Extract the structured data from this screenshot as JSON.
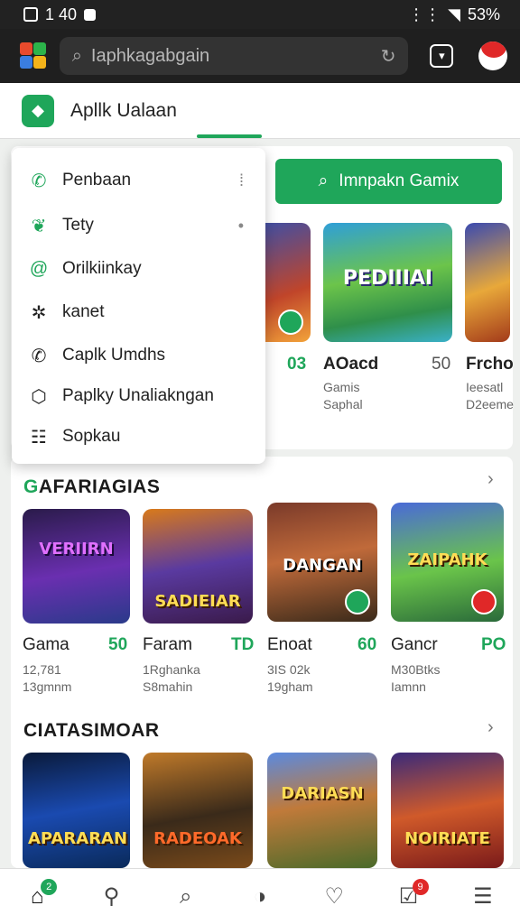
{
  "status_bar": {
    "time": "1 40",
    "battery": "53%"
  },
  "topbar": {
    "search_text": "Iaphkagabgain"
  },
  "header": {
    "title": "Apllk Ualaan"
  },
  "menu": {
    "items": [
      {
        "label": "Penbaan",
        "icon": "phone-icon"
      },
      {
        "label": "Tety",
        "icon": "leaf-icon"
      },
      {
        "label": "Orilkiinkay",
        "icon": "link-icon"
      },
      {
        "label": "kanet",
        "icon": "gear-icon"
      },
      {
        "label": "Caplk Umdhs",
        "icon": "phone-outline-icon"
      },
      {
        "label": "Paplky Unaliakngan",
        "icon": "camera-icon"
      },
      {
        "label": "Sopkau",
        "icon": "clipboard-icon"
      }
    ]
  },
  "install_button": {
    "label": "Imnpakn Gamix"
  },
  "featured": {
    "tiles": [
      {
        "banner": "PEDIIIAI"
      }
    ],
    "rows": [
      {
        "score": "03"
      },
      {
        "name": "AOacd",
        "score": "50",
        "sub1": "Gamis",
        "sub2": "Saphal"
      },
      {
        "name": "Frcho",
        "sub1": "Ieesatl",
        "sub2": "D2eeme"
      }
    ]
  },
  "section1": {
    "title_prefix": "G",
    "title_rest": "AFARIAGIAS",
    "games": [
      {
        "banner": "VERIIRN",
        "name": "Gama",
        "score": "50",
        "sub1": "12,781",
        "sub2": "13gmnm"
      },
      {
        "banner": "SADIEIAR",
        "name": "Faram",
        "score": "TD",
        "sub1": "1Rghanka",
        "sub2": "S8mahin"
      },
      {
        "banner": "DANGAN",
        "name": "Enoat",
        "score": "60",
        "sub1": "3IS 02k",
        "sub2": "19gham"
      },
      {
        "banner": "ZAIPAHK",
        "name": "Gancr",
        "score": "PO",
        "sub1": "M30Btks",
        "sub2": "Iamnn"
      }
    ]
  },
  "section2": {
    "title": "CIATASIMOAR",
    "games": [
      {
        "banner": "APARARAN"
      },
      {
        "banner": "RADEOAK"
      },
      {
        "banner": "DARIASN"
      },
      {
        "banner": "NOIRIATE"
      }
    ]
  },
  "bottom_nav": {
    "home_badge": "2",
    "cart_badge": "9"
  }
}
